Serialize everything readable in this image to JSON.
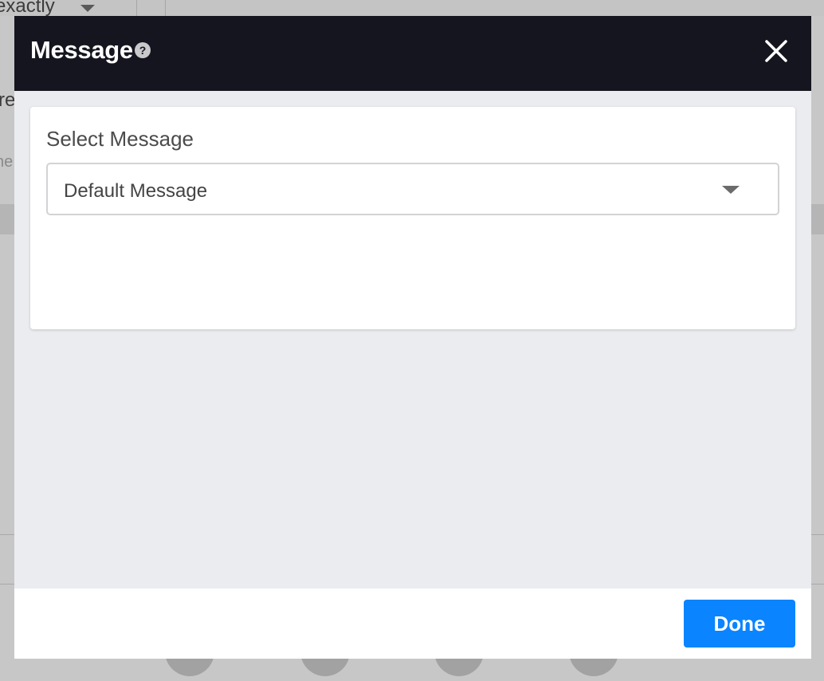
{
  "background": {
    "top_select_text": "exactly",
    "partial_text_1": "re",
    "partial_text_2": "ne"
  },
  "modal": {
    "title": "Message",
    "help_icon": "question-circle-icon",
    "help_glyph": "?",
    "close_icon": "close-icon",
    "select": {
      "label": "Select Message",
      "value": "Default Message",
      "caret_icon": "chevron-down-icon"
    },
    "footer": {
      "done_label": "Done"
    }
  },
  "colors": {
    "header_bg": "#14151e",
    "body_bg": "#ebecf0",
    "accent": "#0a84ff"
  }
}
